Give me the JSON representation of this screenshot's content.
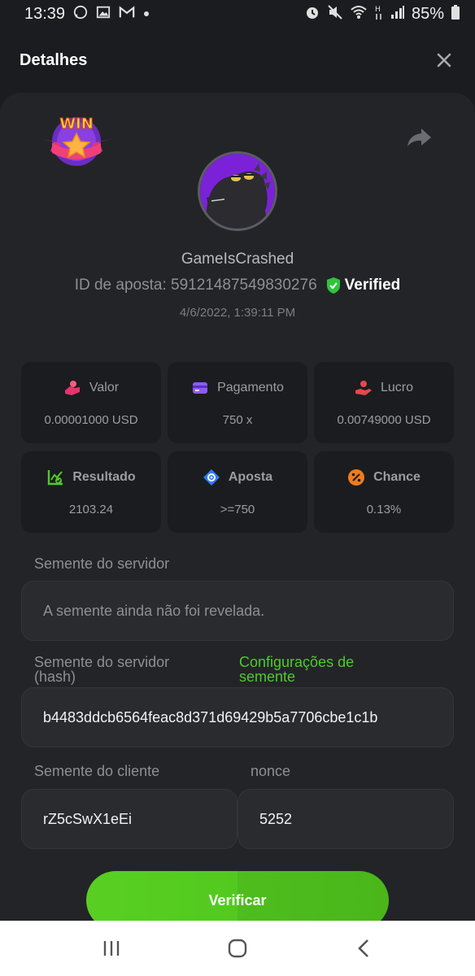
{
  "status_bar": {
    "time": "13:39",
    "battery": "85%",
    "left_icons": [
      "whatsapp-icon",
      "image-icon",
      "gmail-icon",
      "dot-icon"
    ],
    "right_icons": [
      "alarm-icon",
      "mute-icon",
      "wifi-icon",
      "hplus-icon",
      "signal-icon",
      "battery-icon"
    ]
  },
  "header": {
    "title": "Detalhes",
    "close_icon": "close-icon"
  },
  "bet": {
    "badge_text": "WIN",
    "username": "GameIsCrashed",
    "bet_id_label": "ID de aposta: 59121487549830276",
    "verified_label": "Verified",
    "timestamp": "4/6/2022, 1:39:11 PM"
  },
  "stats": [
    {
      "label": "Valor",
      "value": "0.00001000 USD",
      "icon": "coins-icon",
      "color": "#e8336e"
    },
    {
      "label": "Pagamento",
      "value": "750 x",
      "icon": "card-icon",
      "color": "#8b5cf6"
    },
    {
      "label": "Lucro",
      "value": "0.00749000 USD",
      "icon": "profit-hand-icon",
      "color": "#e5484d"
    },
    {
      "label": "Resultado",
      "value": "2103.24",
      "icon": "chart-check-icon",
      "color": "#4ecb2a"
    },
    {
      "label": "Aposta",
      "value": ">=750",
      "icon": "target-diamond-icon",
      "color": "#2f7bf5"
    },
    {
      "label": "Chance",
      "value": "0.13%",
      "icon": "percent-icon",
      "color": "#f07b1d"
    }
  ],
  "fields": {
    "server_seed_label": "Semente do servidor",
    "server_seed_placeholder": "A semente ainda não foi revelada.",
    "server_seed_hash_label_line1": "Semente do servidor",
    "server_seed_hash_label_line2": "(hash)",
    "seed_settings_line1": "Configurações de",
    "seed_settings_line2": "semente",
    "server_seed_hash_value": "b4483ddcb6564feac8d371d69429b5a7706cbe1c1b",
    "client_seed_label": "Semente do cliente",
    "client_seed_value": "rZ5cSwX1eEi",
    "nonce_label": "nonce",
    "nonce_value": "5252"
  },
  "actions": {
    "verify_label": "Verificar"
  },
  "colors": {
    "accent_green": "#4ecb2a",
    "background": "#1b1c1f",
    "panel": "#232427"
  }
}
